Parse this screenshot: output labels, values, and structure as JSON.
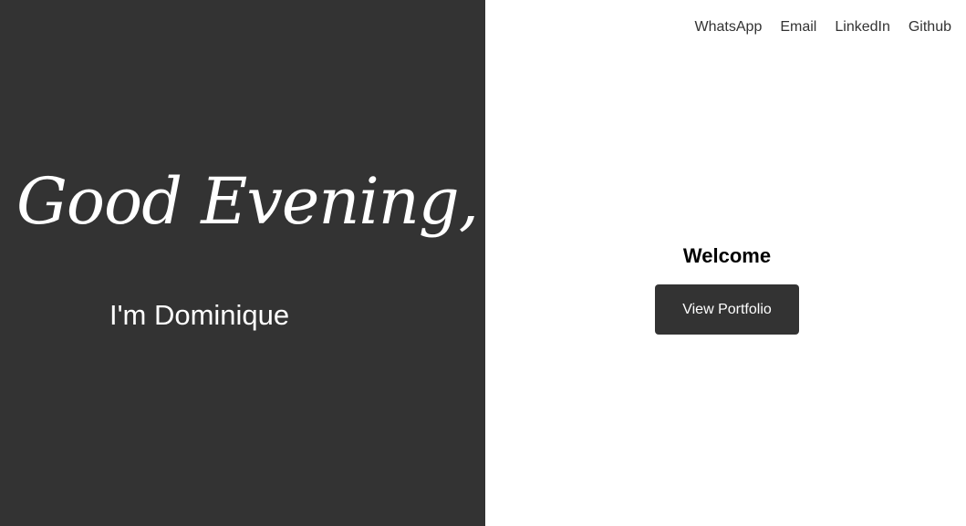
{
  "hero": {
    "greeting": "Good Evening,",
    "intro": "I'm Dominique"
  },
  "nav": {
    "items": [
      {
        "label": "WhatsApp"
      },
      {
        "label": "Email"
      },
      {
        "label": "LinkedIn"
      },
      {
        "label": "Github"
      }
    ]
  },
  "main": {
    "welcome": "Welcome",
    "button_label": "View Portfolio"
  },
  "colors": {
    "dark_panel": "#333333",
    "background": "#ffffff",
    "text_light": "#ffffff"
  }
}
